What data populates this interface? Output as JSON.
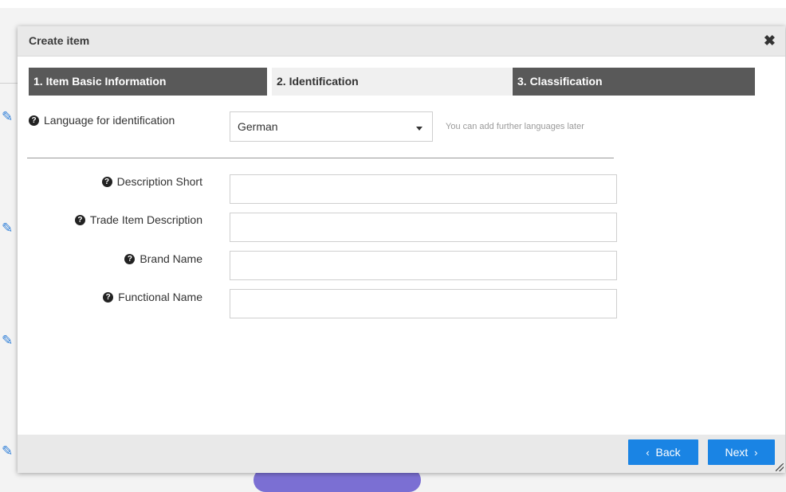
{
  "background": {
    "edit_icon_glyph": "✎"
  },
  "dialog": {
    "title": "Create item",
    "close_glyph": "✖"
  },
  "steps": [
    {
      "label": "1. Item Basic Information"
    },
    {
      "label": "2. Identification"
    },
    {
      "label": "3. Classification"
    }
  ],
  "language": {
    "label": "Language for identification",
    "selected": "German",
    "hint": "You can add further languages later"
  },
  "fields": {
    "description_short": {
      "label": "Description Short",
      "value": ""
    },
    "trade_item_description": {
      "label": "Trade Item Description",
      "value": ""
    },
    "brand_name": {
      "label": "Brand Name",
      "value": ""
    },
    "functional_name": {
      "label": "Functional Name",
      "value": ""
    }
  },
  "footer": {
    "back_label": "Back",
    "next_label": "Next",
    "back_chevron": "‹",
    "next_chevron": "›"
  },
  "colors": {
    "primary_button": "#1a84e4",
    "active_step": "#595959",
    "inactive_step": "#f0f0f0",
    "edit_icon": "#2f7fd8"
  },
  "icons": {
    "help": "help-circle-icon",
    "edit": "edit-pencil-icon",
    "close": "close-icon",
    "dropdown": "caret-down-icon"
  }
}
